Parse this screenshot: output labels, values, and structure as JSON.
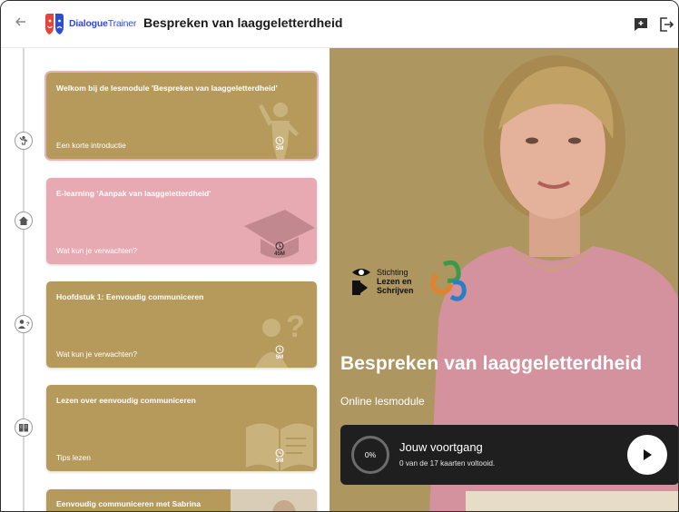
{
  "topbar": {
    "brand_main": "Dialogue",
    "brand_suffix": "Trainer",
    "title": "Bespreken van laaggeletterdheid"
  },
  "cards": [
    {
      "title": "Welkom bij de lesmodule 'Bespreken van laaggeletterdheid'",
      "subtitle": "Een korte introductie",
      "duration": "5M",
      "illustration": "person-waving-icon",
      "timeline_icon": "person-waving-icon"
    },
    {
      "title": "E-learning 'Aanpak van laaggeletterdheid'",
      "subtitle": "Wat kun je verwachten?",
      "duration": "45M",
      "illustration": "graduation-cap-icon",
      "timeline_icon": "home-icon"
    },
    {
      "title": "Hoofdstuk 1: Eenvoudig communiceren",
      "subtitle": "Wat kun je verwachten?",
      "duration": "5M",
      "illustration": "person-question-icon",
      "timeline_icon": "person-question-icon"
    },
    {
      "title": "Lezen over eenvoudig communiceren",
      "subtitle": "Tips lezen",
      "duration": "5M",
      "illustration": "open-book-icon",
      "timeline_icon": "book-icon"
    },
    {
      "title": "Eenvoudig communiceren met Sabrina",
      "subtitle": "",
      "duration": "",
      "illustration": "",
      "timeline_icon": ""
    }
  ],
  "hero": {
    "partner_name_line1": "Stichting",
    "partner_name_line2": "Lezen en",
    "partner_name_line3": "Schrijven",
    "title": "Bespreken van laaggeletterdheid",
    "subtitle": "Online lesmodule",
    "progress": {
      "percent_label": "0%",
      "percent_value": 0,
      "title": "Jouw voortgang",
      "text": "0 van de 17 kaarten voltooid."
    }
  },
  "colors": {
    "card_gold": "#b69a5c",
    "card_pink": "#e8aab2",
    "hero_bg": "#ad9660",
    "brand_blue": "#2e4bd6",
    "brand_red": "#e8423b",
    "progress_bg": "#1f1f1f"
  }
}
